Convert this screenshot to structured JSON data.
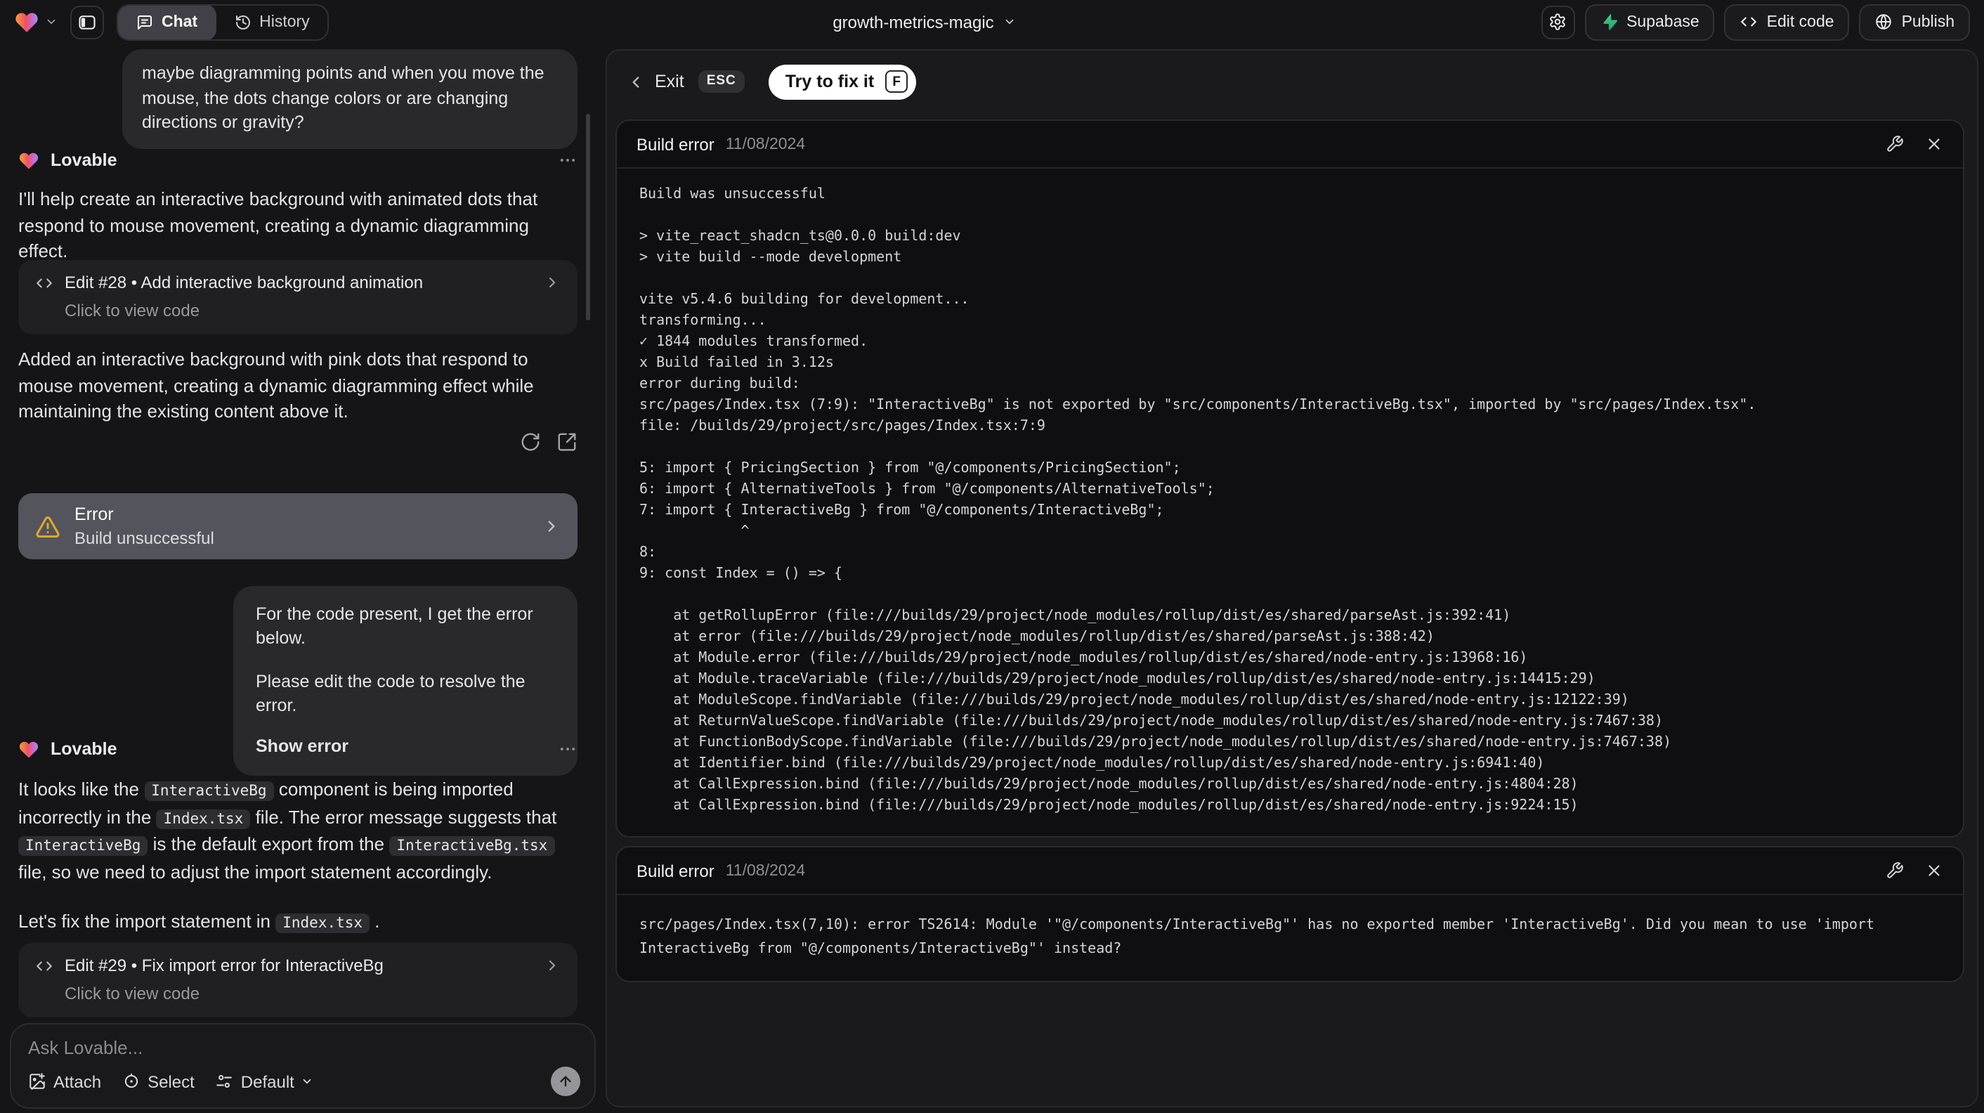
{
  "topbar": {
    "project_name": "growth-metrics-magic",
    "chat_tab": "Chat",
    "history_tab": "History",
    "supabase_label": "Supabase",
    "edit_code_label": "Edit code",
    "publish_label": "Publish"
  },
  "chat": {
    "assistant_name": "Lovable",
    "user_message_1": "maybe diagramming points and when you move the mouse, the dots change colors or are changing directions or gravity?",
    "assistant_intro": "I'll help create an interactive background with animated dots that respond to mouse movement, creating a dynamic diagramming effect.",
    "edit_card_28_title": "Edit #28 • Add interactive background animation",
    "edit_card_28_subtitle": "Click to view code",
    "assistant_summary": "Added an interactive background with pink dots that respond to mouse movement, creating a dynamic diagramming effect while maintaining the existing content above it.",
    "error_card_title": "Error",
    "error_card_subtitle": "Build unsuccessful",
    "user_message_2_line1": "For the code present, I get the error below.",
    "user_message_2_line2": "Please edit the code to resolve the error.",
    "user_message_2_action": "Show error",
    "assistant_fix_parts": [
      "It looks like the ",
      "InteractiveBg",
      " component is being imported incorrectly in the ",
      "Index.tsx",
      " file. The error message suggests that ",
      "InteractiveBg",
      " is the default export from the ",
      "InteractiveBg.tsx",
      " file, so we need to adjust the import statement accordingly."
    ],
    "assistant_fix_line2": [
      "Let's fix the import statement in ",
      "Index.tsx",
      " ."
    ],
    "edit_card_29_title": "Edit #29 • Fix import error for InteractiveBg",
    "edit_card_29_subtitle": "Click to view code",
    "input_placeholder": "Ask Lovable...",
    "attach_label": "Attach",
    "select_label": "Select",
    "mode_label": "Default"
  },
  "preview": {
    "exit_label": "Exit",
    "esc_key": "ESC",
    "fix_button_label": "Try to fix it",
    "fix_button_key": "F",
    "error_card_1": {
      "title": "Build error",
      "date": "11/08/2024",
      "console": "Build was unsuccessful\n\n> vite_react_shadcn_ts@0.0.0 build:dev\n> vite build --mode development\n\nvite v5.4.6 building for development...\ntransforming...\n✓ 1844 modules transformed.\nx Build failed in 3.12s\nerror during build:\nsrc/pages/Index.tsx (7:9): \"InteractiveBg\" is not exported by \"src/components/InteractiveBg.tsx\", imported by \"src/pages/Index.tsx\".\nfile: /builds/29/project/src/pages/Index.tsx:7:9\n\n5: import { PricingSection } from \"@/components/PricingSection\";\n6: import { AlternativeTools } from \"@/components/AlternativeTools\";\n7: import { InteractiveBg } from \"@/components/InteractiveBg\";\n            ^\n8:\n9: const Index = () => {\n\n    at getRollupError (file:///builds/29/project/node_modules/rollup/dist/es/shared/parseAst.js:392:41)\n    at error (file:///builds/29/project/node_modules/rollup/dist/es/shared/parseAst.js:388:42)\n    at Module.error (file:///builds/29/project/node_modules/rollup/dist/es/shared/node-entry.js:13968:16)\n    at Module.traceVariable (file:///builds/29/project/node_modules/rollup/dist/es/shared/node-entry.js:14415:29)\n    at ModuleScope.findVariable (file:///builds/29/project/node_modules/rollup/dist/es/shared/node-entry.js:12122:39)\n    at ReturnValueScope.findVariable (file:///builds/29/project/node_modules/rollup/dist/es/shared/node-entry.js:7467:38)\n    at FunctionBodyScope.findVariable (file:///builds/29/project/node_modules/rollup/dist/es/shared/node-entry.js:7467:38)\n    at Identifier.bind (file:///builds/29/project/node_modules/rollup/dist/es/shared/node-entry.js:6941:40)\n    at CallExpression.bind (file:///builds/29/project/node_modules/rollup/dist/es/shared/node-entry.js:4804:28)\n    at CallExpression.bind (file:///builds/29/project/node_modules/rollup/dist/es/shared/node-entry.js:9224:15)"
    },
    "error_card_2": {
      "title": "Build error",
      "date": "11/08/2024",
      "console": "src/pages/Index.tsx(7,10): error TS2614: Module '\"@/components/InteractiveBg\"' has no exported member 'InteractiveBg'. Did you mean to use 'import InteractiveBg from \"@/components/InteractiveBg\"' instead?"
    }
  },
  "colors": {
    "supabase_green": "#3ecf8e",
    "warning_amber": "#e0a82e",
    "fix_pill_white": "#ffffff",
    "error_card_gray": "#54555c"
  }
}
